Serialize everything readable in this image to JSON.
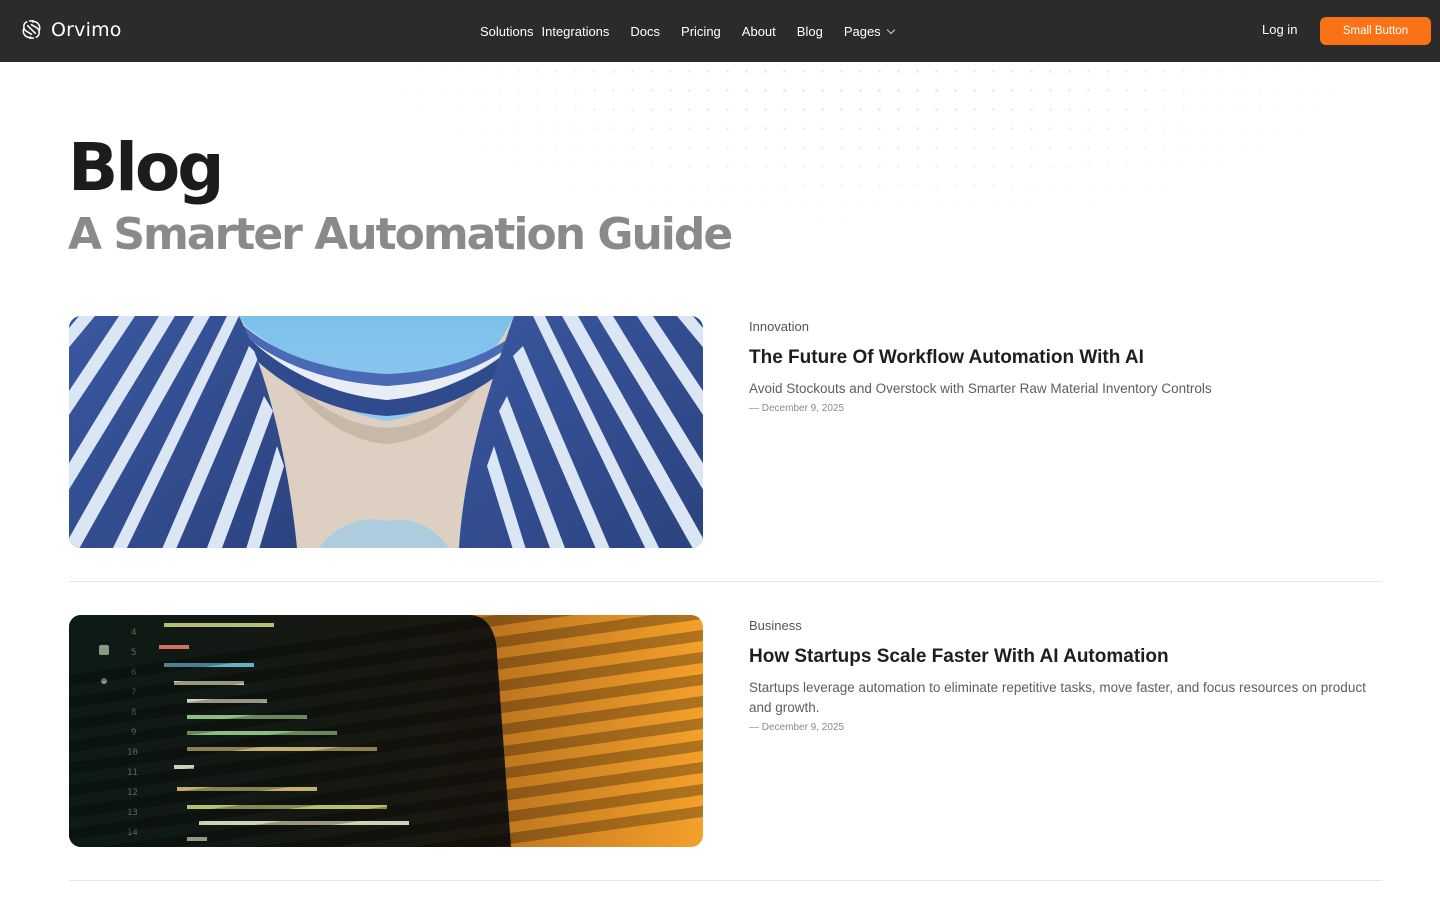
{
  "brand": {
    "name": "Orvimo",
    "logo_icon": "orvimo-logo-icon"
  },
  "nav": {
    "links": [
      {
        "label": "Solutions"
      },
      {
        "label": "Integrations"
      },
      {
        "label": "Docs"
      },
      {
        "label": "Pricing"
      },
      {
        "label": "About"
      },
      {
        "label": "Blog"
      },
      {
        "label": "Pages"
      }
    ],
    "pages_icon": "chevron-down-icon",
    "login_label": "Log in",
    "cta_label": "Small Button",
    "cta_color": "#f97316",
    "bg_color": "#2b2b2b"
  },
  "hero": {
    "title": "Blog",
    "subtitle": "A Smarter Automation Guide"
  },
  "posts": [
    {
      "category": "Innovation",
      "title": "The Future Of Workflow Automation With AI",
      "excerpt": "Avoid Stockouts and Overstock with Smarter Raw Material Inventory Controls",
      "date": "— December 9, 2025",
      "image": "architecture-photo"
    },
    {
      "category": "Business",
      "title": "How Startups Scale Faster With AI Automation",
      "excerpt": "Startups leverage automation to eliminate repetitive tasks, move faster, and focus resources on product and growth.",
      "date": "— December 9, 2025",
      "image": "code-screen-photo"
    }
  ]
}
